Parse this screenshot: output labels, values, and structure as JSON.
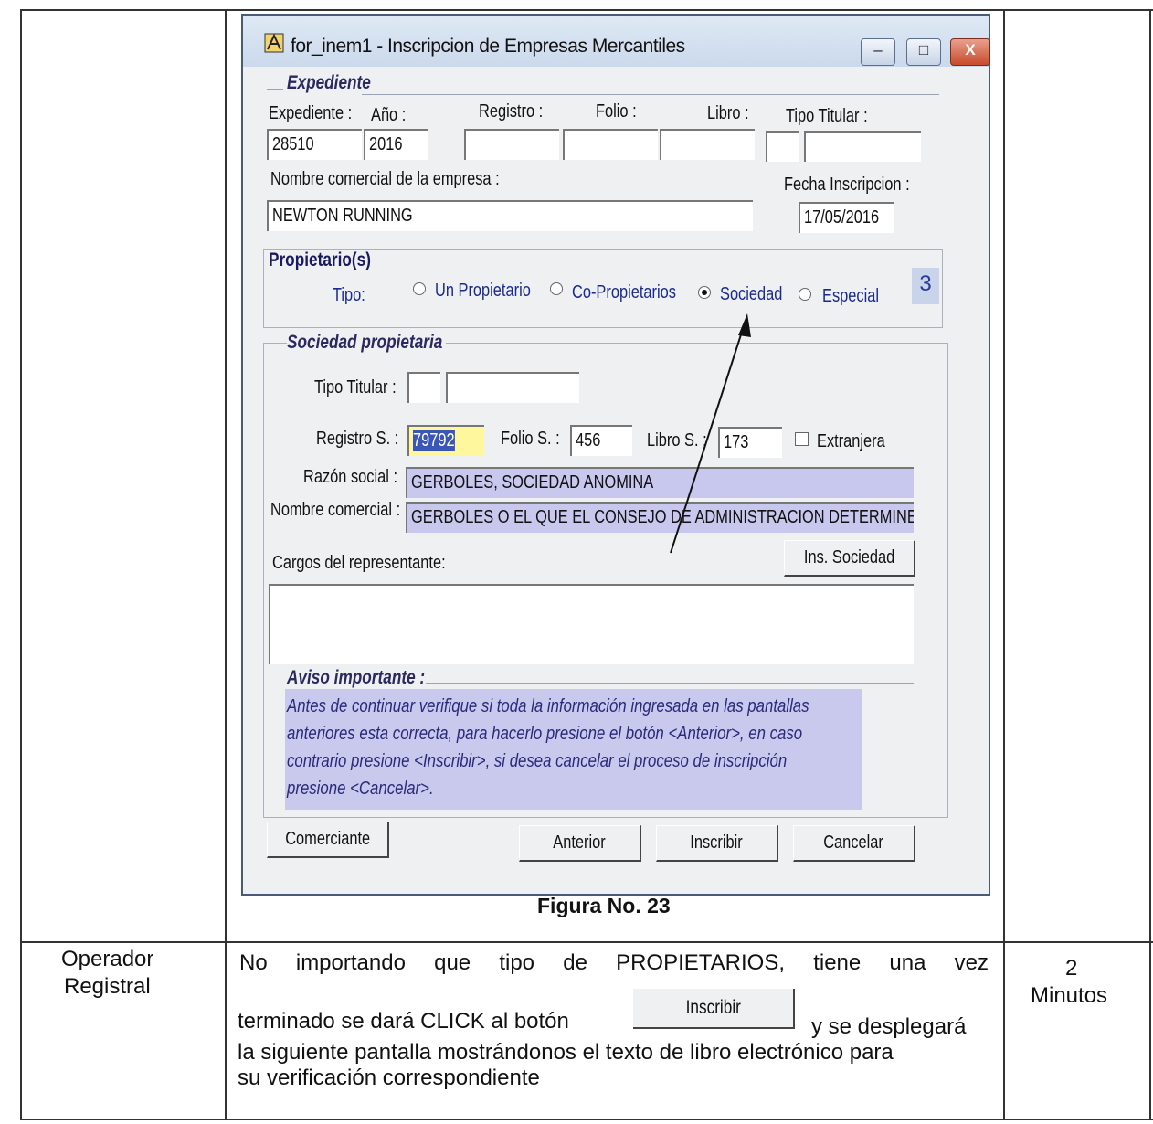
{
  "window": {
    "title": "for_inem1 - Inscripcion de Empresas Mercantiles",
    "minimize": "–",
    "maximize": "□",
    "close": "X"
  },
  "expediente": {
    "section_title": "Expediente",
    "labels": {
      "expediente": "Expediente :",
      "anio": "Año :",
      "registro": "Registro :",
      "folio": "Folio :",
      "libro": "Libro :",
      "tipo_titular": "Tipo Titular :",
      "nombre_comercial": "Nombre comercial de la empresa :",
      "fecha_inscripcion": "Fecha Inscripcion :"
    },
    "values": {
      "expediente": "28510",
      "anio": "2016",
      "nombre_comercial": "NEWTON RUNNING",
      "fecha_inscripcion": "17/05/2016"
    }
  },
  "propietarios": {
    "section_title": "Propietario(s)",
    "tipo_label": "Tipo:",
    "options": [
      "Un Propietario",
      "Co-Propietarios",
      "Sociedad",
      "Especial"
    ],
    "selected": "Sociedad",
    "count": "3"
  },
  "sociedad": {
    "section_title": "Sociedad propietaria",
    "labels": {
      "tipo_titular": "Tipo Titular :",
      "registro": "Registro S. :",
      "folio": "Folio S. :",
      "libro": "Libro S. :",
      "extranjera": "Extranjera",
      "razon_social": "Razón social :",
      "nombre_comercial": "Nombre comercial :",
      "cargos": "Cargos del representante:"
    },
    "values": {
      "registro": "79792",
      "folio": "456",
      "libro": "173",
      "razon_social": "GERBOLES, SOCIEDAD ANOMINA",
      "nombre_comercial": "GERBOLES O EL QUE EL CONSEJO DE ADMINISTRACION DETERMINE"
    },
    "ins_button": "Ins. Sociedad"
  },
  "aviso": {
    "title": "Aviso importante :",
    "lines": [
      "Antes de continuar verifique si toda la información ingresada en las pantallas",
      "anteriores esta correcta, para hacerlo presione el botón <Anterior>, en caso",
      "contrario presione <Inscribir>, si desea cancelar el proceso de inscripción",
      "presione <Cancelar>."
    ]
  },
  "buttons": {
    "comerciante": "Comerciante",
    "anterior": "Anterior",
    "inscribir": "Inscribir",
    "cancelar": "Cancelar"
  },
  "caption": "Figura No. 23",
  "row": {
    "role_line1": "Operador",
    "role_line2": "Registral",
    "text_line1": "No importando que tipo de PROPIETARIOS, tiene una vez",
    "text_line2a": "terminado se dará CLICK al botón",
    "text_line2b": "y se desplegará",
    "text_line3": "la siguiente pantalla mostrándonos el texto de libro electrónico para",
    "text_line4": "su verificación correspondiente",
    "button_label": "Inscribir",
    "time_line1": "2",
    "time_line2": "Minutos"
  }
}
